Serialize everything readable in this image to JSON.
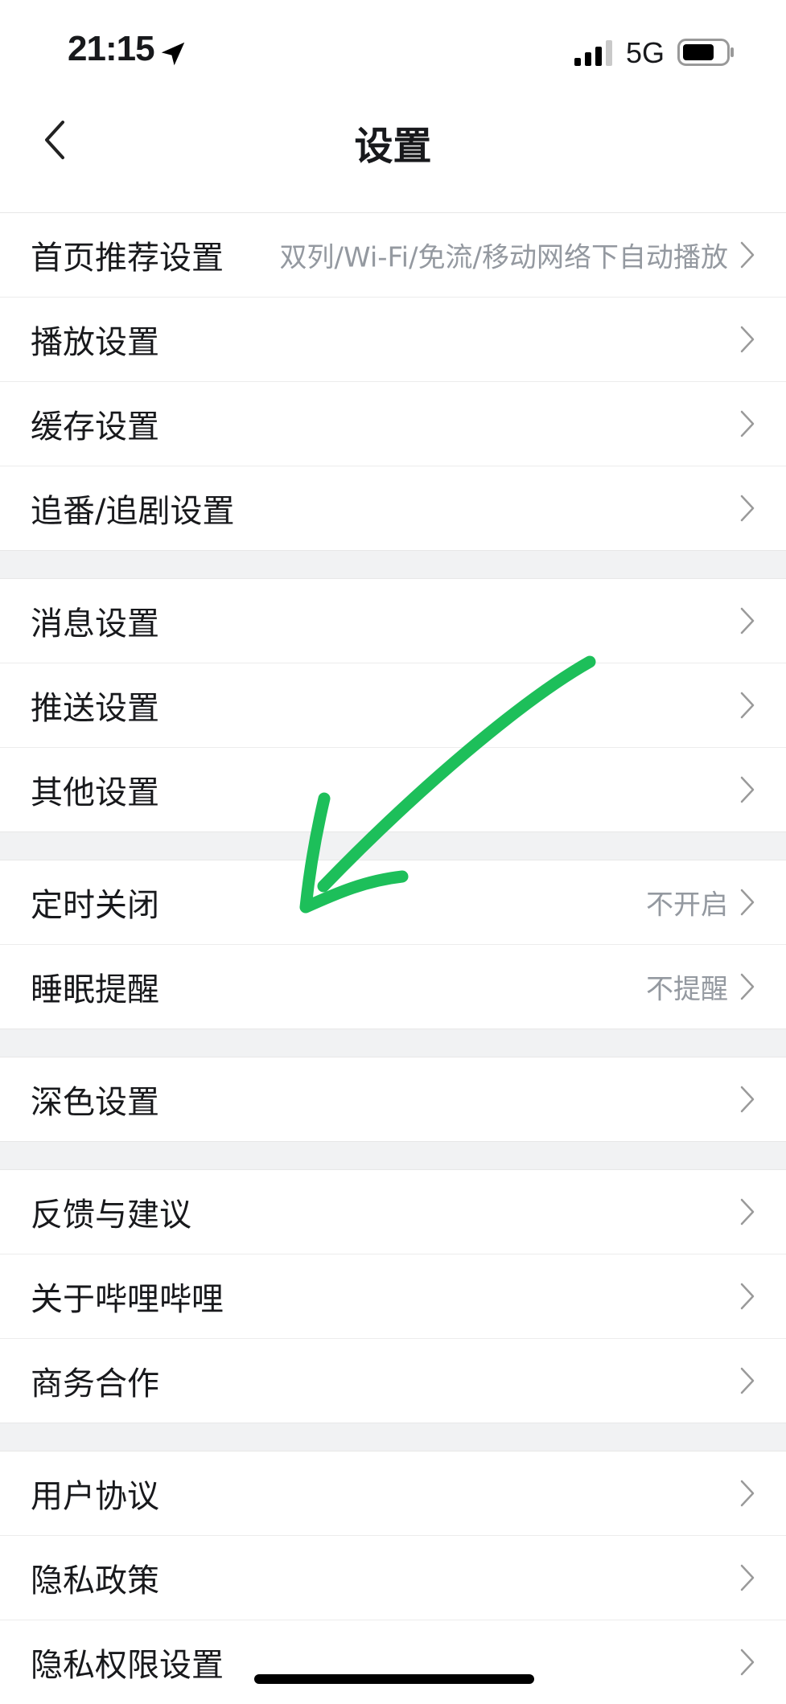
{
  "status_bar": {
    "time": "21:15",
    "network": "5G",
    "icons": [
      "location-arrow-icon",
      "signal-icon",
      "battery-icon"
    ]
  },
  "nav": {
    "title": "设置",
    "back_icon": "chevron-left-icon"
  },
  "groups": [
    [
      {
        "label": "首页推荐设置",
        "value": "双列/Wi-Fi/免流/移动网络下自动播放"
      },
      {
        "label": "播放设置",
        "value": ""
      },
      {
        "label": "缓存设置",
        "value": ""
      },
      {
        "label": "追番/追剧设置",
        "value": ""
      }
    ],
    [
      {
        "label": "消息设置",
        "value": ""
      },
      {
        "label": "推送设置",
        "value": ""
      },
      {
        "label": "其他设置",
        "value": ""
      }
    ],
    [
      {
        "label": "定时关闭",
        "value": "不开启"
      },
      {
        "label": "睡眠提醒",
        "value": "不提醒"
      }
    ],
    [
      {
        "label": "深色设置",
        "value": ""
      }
    ],
    [
      {
        "label": "反馈与建议",
        "value": ""
      },
      {
        "label": "关于哔哩哔哩",
        "value": ""
      },
      {
        "label": "商务合作",
        "value": ""
      }
    ],
    [
      {
        "label": "用户协议",
        "value": ""
      },
      {
        "label": "隐私政策",
        "value": ""
      },
      {
        "label": "隐私权限设置",
        "value": ""
      }
    ]
  ],
  "colors": {
    "annotation_arrow": "#1dbf5a",
    "secondary_text": "#9499a0",
    "divider_bg": "#f1f2f3"
  }
}
